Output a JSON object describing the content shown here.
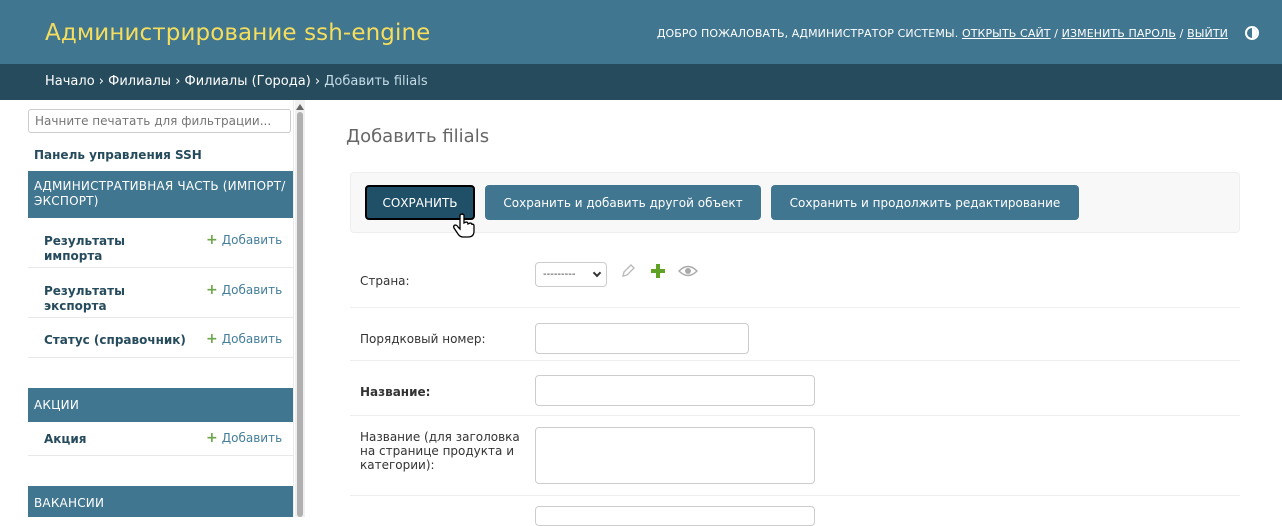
{
  "header": {
    "branding": "Администрирование ssh-engine",
    "welcome": "ДОБРО ПОЖАЛОВАТЬ, АДМИНИСТРАТОР СИСТЕМЫ.",
    "view_site": "ОТКРЫТЬ САЙТ",
    "sep1": "/",
    "change_password": "ИЗМЕНИТЬ ПАРОЛЬ",
    "sep2": "/",
    "logout": "ВЫЙТИ"
  },
  "breadcrumbs": {
    "home": "Начало",
    "app": "Филиалы",
    "model": "Филиалы (Города)",
    "current": "Добавить filials",
    "sep": " › "
  },
  "sidebar": {
    "filter_placeholder": "Начните печатать для фильтрации...",
    "dashboard_link": "Панель управления SSH",
    "add_label": "Добавить",
    "modules": [
      {
        "title": "АДМИНИСТРАТИВНАЯ ЧАСТЬ (ИМПОРТ/ЭКСПОРТ)",
        "models": [
          "Результаты импорта",
          "Результаты экспорта",
          "Статус (справочник)"
        ]
      },
      {
        "title": "АКЦИИ",
        "models": [
          "Акция"
        ]
      },
      {
        "title": "ВАКАНСИИ",
        "models": []
      }
    ]
  },
  "main": {
    "title": "Добавить filials",
    "buttons": {
      "save": "СОХРАНИТЬ",
      "save_add": "Сохранить и добавить другой объект",
      "save_continue": "Сохранить и продолжить редактирование"
    },
    "fields": {
      "country_label": "Страна:",
      "country_value": "---------",
      "order_label": "Порядковый номер:",
      "name_label": "Название:",
      "title_label": "Название (для заголовка на странице продукта и категории):"
    }
  },
  "icons": [
    "pencil-icon",
    "plus-icon",
    "eye-icon",
    "theme-toggle-icon",
    "cursor-hand-icon"
  ]
}
